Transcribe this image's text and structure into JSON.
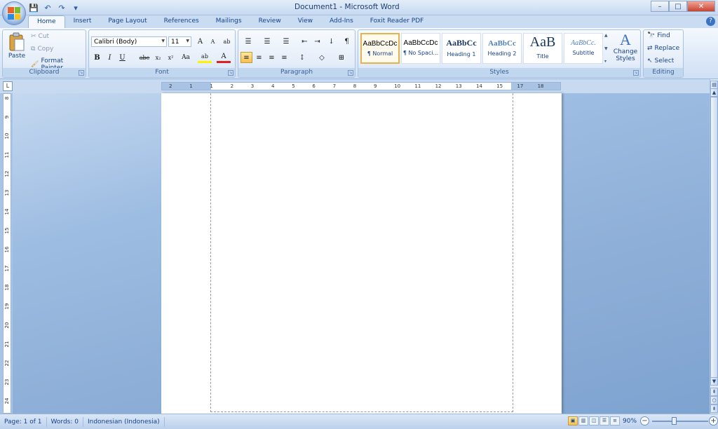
{
  "window": {
    "title": "Document1 - Microsoft Word",
    "controls": {
      "minimize": "–",
      "maximize": "□",
      "close": "✕"
    }
  },
  "quick_access": {
    "save_icon": "💾",
    "undo_icon": "↶",
    "redo_icon": "↷",
    "more_icon": "▾"
  },
  "tabs": [
    {
      "label": "Home",
      "active": true
    },
    {
      "label": "Insert"
    },
    {
      "label": "Page Layout"
    },
    {
      "label": "References"
    },
    {
      "label": "Mailings"
    },
    {
      "label": "Review"
    },
    {
      "label": "View"
    },
    {
      "label": "Add-Ins"
    },
    {
      "label": "Foxit Reader PDF"
    }
  ],
  "help_icon": "?",
  "clipboard": {
    "label": "Clipboard",
    "paste": "Paste",
    "cut": "Cut",
    "copy": "Copy",
    "format_painter": "Format Painter"
  },
  "font": {
    "label": "Font",
    "family": "Calibri (Body)",
    "size": "11",
    "grow": "A",
    "shrink": "A",
    "clear": "ab",
    "bold": "B",
    "italic": "I",
    "underline": "U",
    "strike": "abe",
    "subscript": "x₂",
    "superscript": "x²",
    "change_case": "Aa",
    "highlight": "ab",
    "font_color": "A"
  },
  "paragraph": {
    "label": "Paragraph",
    "bullets": "☰",
    "numbering": "☰",
    "multilevel": "☰",
    "decrease_indent": "⇤",
    "increase_indent": "⇥",
    "sort": "↓",
    "show_marks": "¶",
    "align_left": "≡",
    "align_center": "≡",
    "align_right": "≡",
    "justify": "≡",
    "line_spacing": "↕",
    "shading": "◇",
    "borders": "⊞"
  },
  "styles": {
    "label": "Styles",
    "items": [
      {
        "preview": "AaBbCcDc",
        "name": "¶ Normal",
        "active": true
      },
      {
        "preview": "AaBbCcDc",
        "name": "¶ No Spaci..."
      },
      {
        "preview": "AaBbCc",
        "name": "Heading 1"
      },
      {
        "preview": "AaBbCc",
        "name": "Heading 2"
      },
      {
        "preview": "AaB",
        "name": "Title"
      },
      {
        "preview": "AaBbCc.",
        "name": "Subtitle"
      }
    ],
    "change_styles": "Change",
    "change_styles2": "Styles"
  },
  "editing": {
    "label": "Editing",
    "find": "Find",
    "replace": "Replace",
    "select": "Select"
  },
  "ruler": {
    "tab_selector": "L",
    "h_ticks": [
      "2",
      "1",
      "1",
      "2",
      "3",
      "4",
      "5",
      "6",
      "7",
      "8",
      "9",
      "10",
      "11",
      "12",
      "13",
      "14",
      "15",
      "17",
      "18"
    ],
    "v_ticks": [
      "8",
      "9",
      "10",
      "11",
      "12",
      "13",
      "14",
      "15",
      "16",
      "17",
      "18",
      "19",
      "20",
      "21",
      "22",
      "23",
      "24"
    ]
  },
  "status": {
    "page": "Page: 1 of 1",
    "words": "Words: 0",
    "language": "Indonesian (Indonesia)",
    "zoom": "90%",
    "zoom_value": 90
  },
  "colors": {
    "accent": "#15428b",
    "highlight_yellow": "#fff200",
    "font_red": "#e02020"
  }
}
